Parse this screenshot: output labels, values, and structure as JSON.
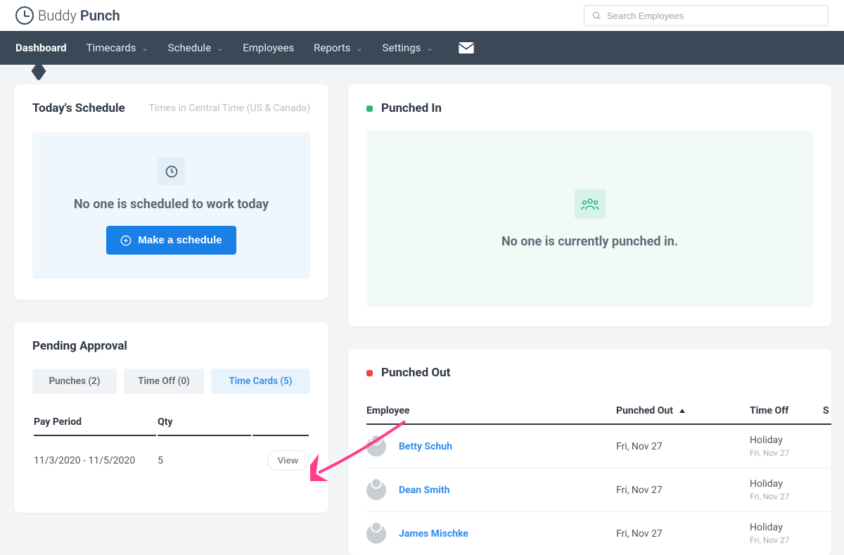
{
  "brand": {
    "name1": "Buddy",
    "name2": "Punch"
  },
  "search": {
    "placeholder": "Search Employees"
  },
  "nav": {
    "dashboard": "Dashboard",
    "timecards": "Timecards",
    "schedule": "Schedule",
    "employees": "Employees",
    "reports": "Reports",
    "settings": "Settings"
  },
  "today": {
    "title": "Today's Schedule",
    "tz": "Times in Central Time (US & Canada)",
    "empty_msg": "No one is scheduled to work today",
    "cta": "Make a schedule"
  },
  "punched_in": {
    "title": "Punched In",
    "empty_msg": "No one is currently punched in."
  },
  "pending": {
    "title": "Pending Approval",
    "tabs": {
      "punches": "Punches (2)",
      "timeoff": "Time Off (0)",
      "timecards": "Time Cards (5)"
    },
    "col_period": "Pay Period",
    "col_qty": "Qty",
    "row": {
      "period": "11/3/2020 - 11/5/2020",
      "qty": "5",
      "view": "View"
    }
  },
  "punched_out": {
    "title": "Punched Out",
    "col_emp": "Employee",
    "col_time": "Punched Out",
    "col_off": "Time Off",
    "col_s": "S",
    "rows": [
      {
        "name": "Betty Schuh",
        "time": "Fri, Nov 27",
        "off": "Holiday",
        "off_sub": "Fri, Nov 27"
      },
      {
        "name": "Dean Smith",
        "time": "Fri, Nov 27",
        "off": "Holiday",
        "off_sub": "Fri, Nov 27"
      },
      {
        "name": "James Mischke",
        "time": "Fri, Nov 27",
        "off": "Holiday",
        "off_sub": "Fri, Nov 27"
      }
    ]
  }
}
